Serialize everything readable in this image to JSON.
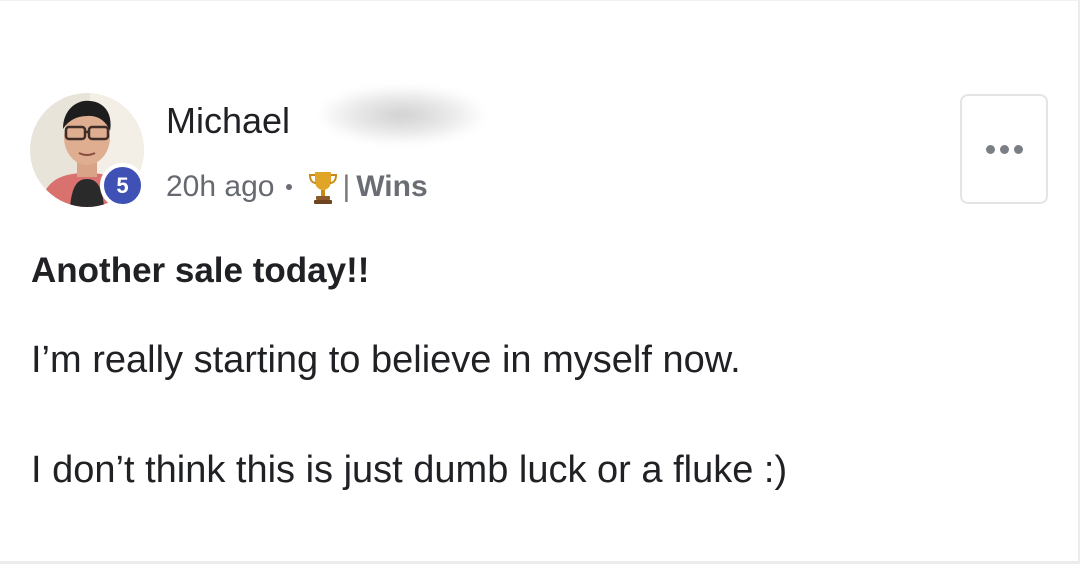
{
  "post": {
    "author": {
      "name": "Michael",
      "level": "5",
      "avatar_icon": "user-avatar-photo"
    },
    "meta": {
      "time_ago": "20h ago",
      "separator": "•",
      "category_icon": "trophy-icon",
      "category_divider": "|",
      "category": "Wins"
    },
    "menu_icon": "more-horizontal-icon",
    "title": "Another sale today!!",
    "body": [
      "I’m really starting to believe in myself now.",
      "I don’t think this is just dumb luck or a fluke :)"
    ]
  },
  "colors": {
    "badge": "#3f51b5",
    "text": "#202124",
    "meta": "#666a70",
    "border": "#e4e4e4"
  }
}
